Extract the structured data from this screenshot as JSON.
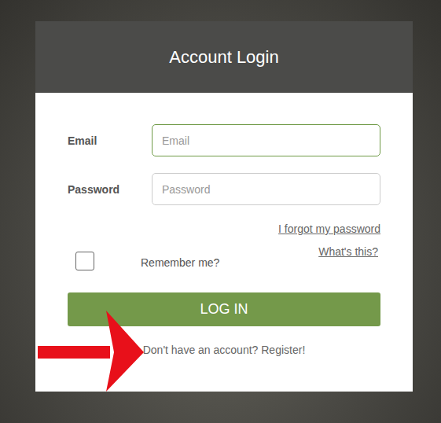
{
  "header": {
    "title": "Account Login"
  },
  "fields": [
    {
      "label": "Email",
      "placeholder": "Email",
      "focused": true
    },
    {
      "label": "Password",
      "placeholder": "Password",
      "focused": false
    }
  ],
  "forgot_link": "I forgot my password",
  "remember": {
    "label": "Remember me?",
    "checked": false
  },
  "whats_this_link": "What's this?",
  "login_button": "LOG IN",
  "register_link": "Don't have an account? Register!"
}
